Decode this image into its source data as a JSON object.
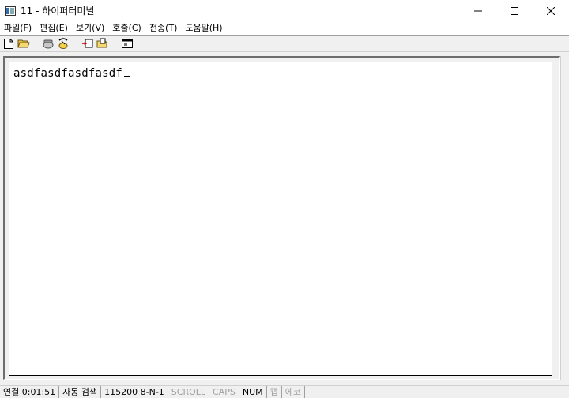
{
  "window": {
    "title": "11 - 하이퍼터미널",
    "controls": {
      "minimize": "—",
      "maximize": "☐",
      "close": "✕"
    }
  },
  "menu": {
    "items": [
      {
        "label": "파일(F)"
      },
      {
        "label": "편집(E)"
      },
      {
        "label": "보기(V)"
      },
      {
        "label": "호출(C)"
      },
      {
        "label": "전송(T)"
      },
      {
        "label": "도움말(H)"
      }
    ]
  },
  "toolbar": {
    "icons": [
      "new-document-icon",
      "open-folder-icon",
      "call-phone-icon",
      "disconnect-phone-icon",
      "send-file-icon",
      "receive-file-icon",
      "properties-icon"
    ]
  },
  "terminal": {
    "content": "asdfasdfasdfasdf"
  },
  "statusbar": {
    "connection": "연결 0:01:51",
    "detect": "자동 검색",
    "settings": "115200 8-N-1",
    "scroll": "SCROLL",
    "caps": "CAPS",
    "num": "NUM",
    "capture": "캡",
    "echo": "에코"
  },
  "colors": {
    "window_bg": "#f0f0f0",
    "terminal_bg": "#ffffff",
    "disabled_text": "#a0a0a0"
  }
}
